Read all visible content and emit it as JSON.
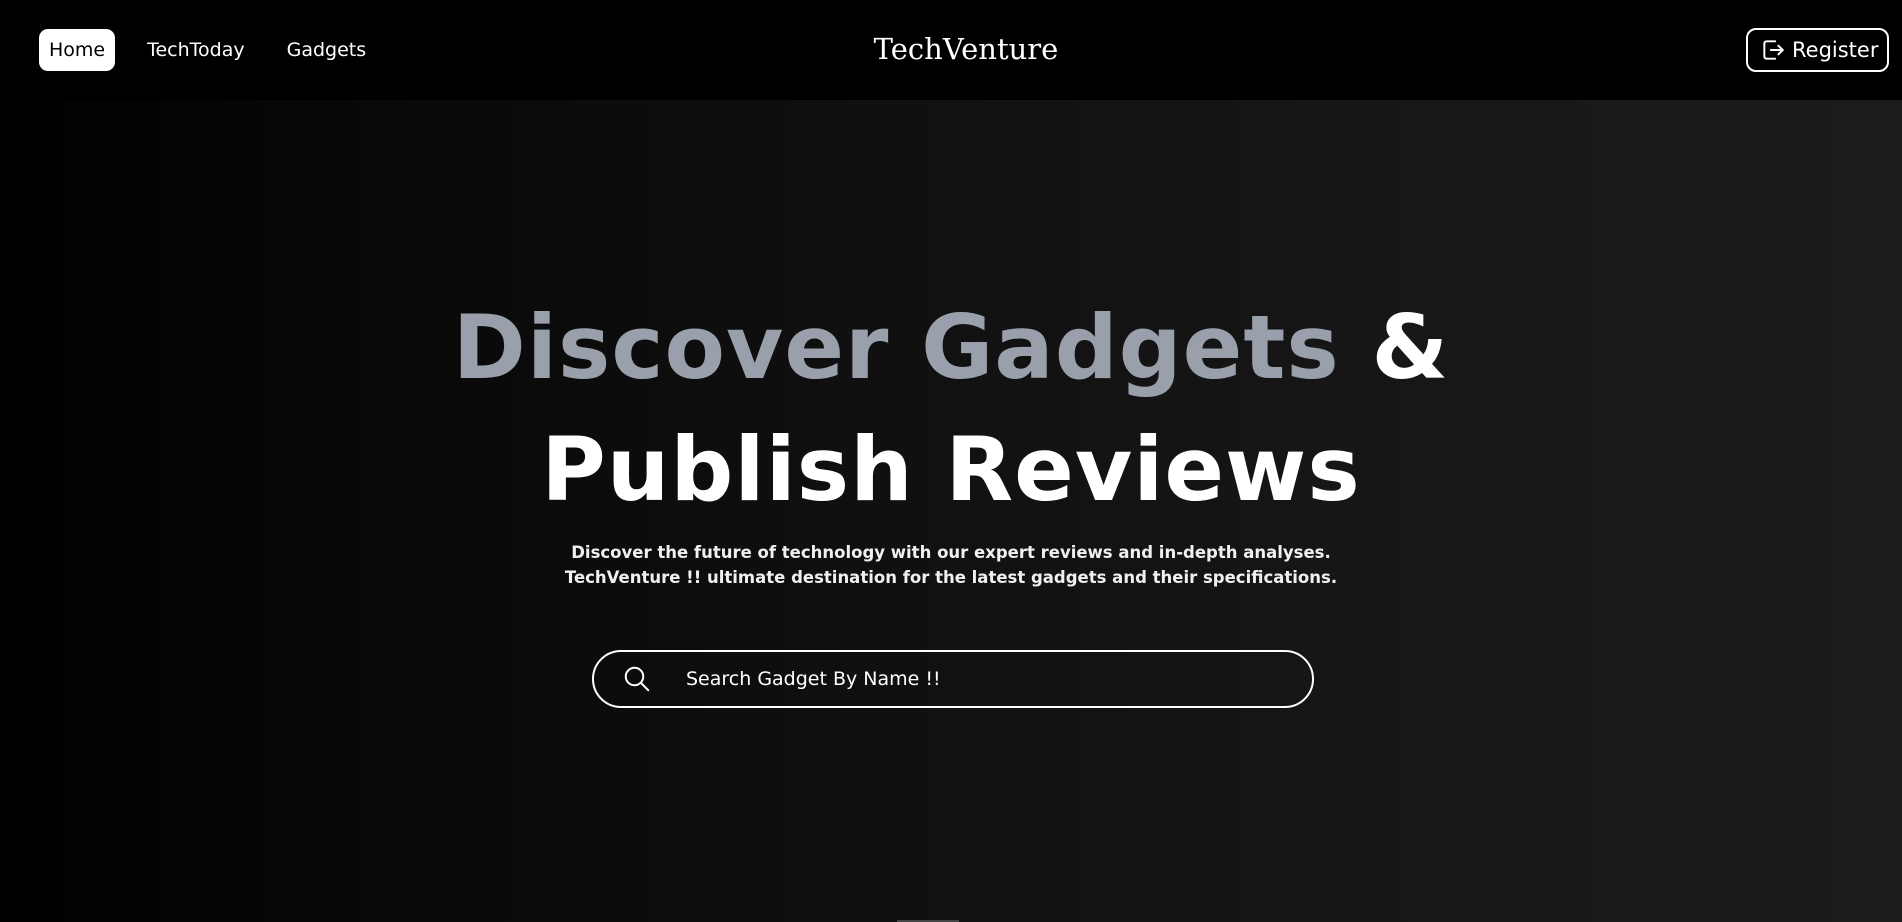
{
  "nav": {
    "links": [
      {
        "label": "Home",
        "active": true
      },
      {
        "label": "TechToday",
        "active": false
      },
      {
        "label": "Gadgets",
        "active": false
      }
    ],
    "brand": "TechVenture",
    "register_label": "Register",
    "register_icon": "logout-icon"
  },
  "hero": {
    "headline_part1": "Discover Gadgets",
    "headline_amp": "&",
    "headline_line2": "Publish Reviews",
    "subtitle_line1": "Discover the future of technology with our expert reviews and in-depth analyses.",
    "subtitle_line2": "TechVenture !! ultimate destination for the latest gadgets and their specifications."
  },
  "search": {
    "placeholder": "Search Gadget By Name !!",
    "value": "",
    "icon": "search-icon"
  },
  "colors": {
    "background": "#000000",
    "accent_gray": "#9aa0ab",
    "text": "#ffffff"
  }
}
